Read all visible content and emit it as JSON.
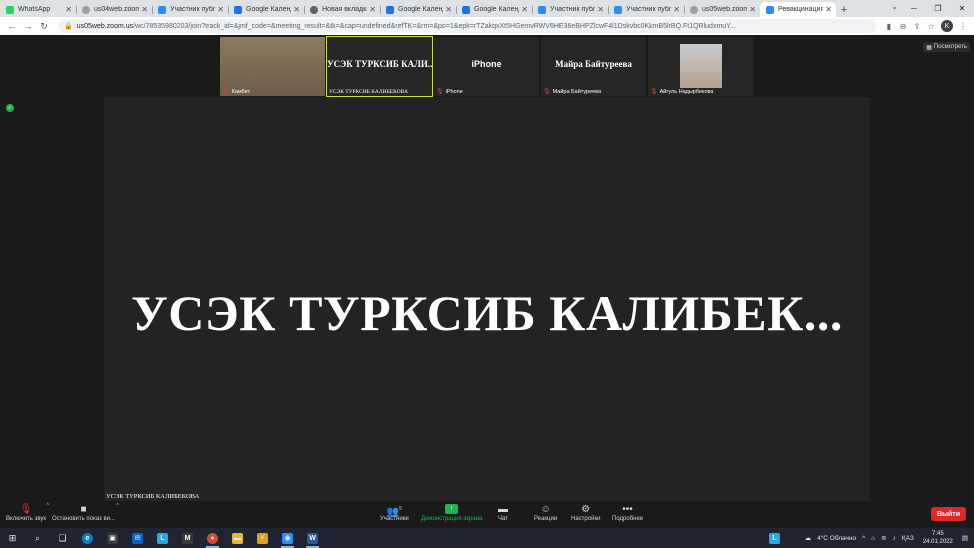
{
  "browser": {
    "tabs": [
      {
        "title": "WhatsApp",
        "favicon_color": "#25d366",
        "favicon": "whatsapp-icon"
      },
      {
        "title": "us04web.zoom.",
        "favicon_color": "#9aa0a6",
        "favicon": "globe-icon"
      },
      {
        "title": "Участник публ.",
        "favicon_color": "#2d8cff",
        "favicon": "zoom-icon"
      },
      {
        "title": "Google Календ.",
        "favicon_color": "#1a73e8",
        "favicon": "calendar-icon"
      },
      {
        "title": "Новая вкладка",
        "favicon_color": "#5f6368",
        "favicon": "globe-icon"
      },
      {
        "title": "Google Календ.",
        "favicon_color": "#1a73e8",
        "favicon": "calendar-icon"
      },
      {
        "title": "Google Календ.",
        "favicon_color": "#1a73e8",
        "favicon": "calendar-icon"
      },
      {
        "title": "Участник публ.",
        "favicon_color": "#2d8cff",
        "favicon": "zoom-icon"
      },
      {
        "title": "Участник публ.",
        "favicon_color": "#2d8cff",
        "favicon": "zoom-icon"
      },
      {
        "title": "us05web.zoom.",
        "favicon_color": "#9aa0a6",
        "favicon": "globe-icon"
      },
      {
        "title": "Ревакцинация",
        "favicon_color": "#2d8cff",
        "favicon": "zoom-icon",
        "active": true
      }
    ],
    "url_host": "us05web.zoom.us",
    "url_path": "/wc/78535980203/join?track_id=&jmf_code=&meeting_result=&tk=&cap=undefined&refTK=&rm=&po=1&epk=rTZakqxXt5HGemvRWV6HE36eBHPZlcwF4l1Dskvbc0KkmB5lrBQ.Ft1QRludxmuY...",
    "profile_initial": "K"
  },
  "meeting": {
    "view_button": "Посмотреть",
    "gallery": [
      {
        "caption": "Камбет",
        "type": "video",
        "muted": true
      },
      {
        "big_name": "УСЭК ТУРКСИБ КАЛИ...",
        "caption": "УСЭК ТУРКСИБ КАЛИБЕКОВА",
        "active": true,
        "muted": false
      },
      {
        "big_name": "iPhone",
        "caption": "iPhone",
        "muted": true
      },
      {
        "big_name": "Майра Байтуреева",
        "caption": "Майра Байтуреева",
        "muted": true
      },
      {
        "caption": "Айгуль Надырбекова",
        "type": "photo",
        "muted": true
      }
    ],
    "speaker_big": "УСЭК ТУРКСИБ КАЛИБЕК...",
    "speaker_small": "УСЭК ТУРКСИБ КАЛИБЕКОВА"
  },
  "controls": {
    "unmute": "Включить звук",
    "stop_video": "Остановить показ ви...",
    "participants": "Участники",
    "participants_count": "5",
    "share_screen": "Демонстрация экрана",
    "chat": "Чат",
    "reactions": "Реакции",
    "settings": "Настройки",
    "more": "Подробнее",
    "leave": "Выйти"
  },
  "taskbar": {
    "weather": "4°C Облачно",
    "lang": "ҚАЗ",
    "time": "7:45",
    "date": "24.01.2022"
  }
}
